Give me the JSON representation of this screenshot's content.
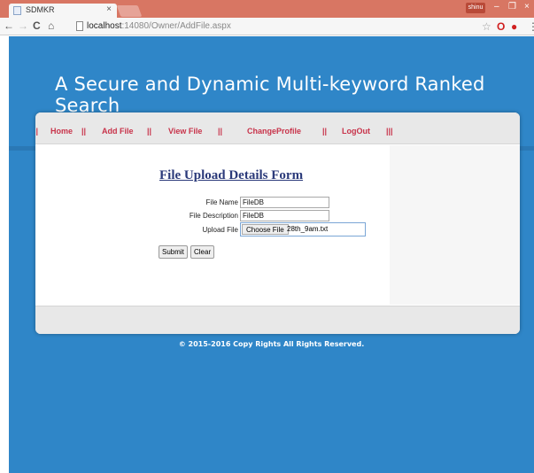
{
  "browser": {
    "tab_title": "SDMKR",
    "tab_close": "×",
    "user_badge": "shinu",
    "window_controls": {
      "minimize": "–",
      "restore": "❐",
      "close": "×"
    },
    "nav": {
      "back": "←",
      "forward": "→",
      "reload": "C",
      "home": "⌂"
    },
    "url_host": "localhost",
    "url_path": ":14080/Owner/AddFile.aspx",
    "icons": [
      "star-icon",
      "opera-icon",
      "adblock-icon",
      "menu-icon"
    ]
  },
  "site": {
    "title": "A Secure and Dynamic Multi-keyword Ranked Search",
    "colors": {
      "background": "#2f86c8",
      "menu_text": "#c8334a",
      "form_title": "#2b3a7a"
    }
  },
  "menu": {
    "sep_left": "||",
    "home": "Home",
    "sep1": "||",
    "add_file": "Add File",
    "sep2": "||",
    "view_file": "View File",
    "sep3": "||",
    "change_profile": "ChangeProfile",
    "sep4": "||",
    "logout": "LogOut",
    "sep5": "|||"
  },
  "form": {
    "title": "File Upload Details Form",
    "file_name_label": "File Name",
    "file_name_value": "FileDB",
    "file_desc_label": "File Description",
    "file_desc_value": "FileDB",
    "upload_label": "Upload File",
    "choose_file_label": "Choose File",
    "chosen_file": "28th_9am.txt",
    "submit_label": "Submit",
    "clear_label": "Clear"
  },
  "footer": {
    "copyright": "© 2015-2016 Copy Rights All Rights Reserved."
  }
}
